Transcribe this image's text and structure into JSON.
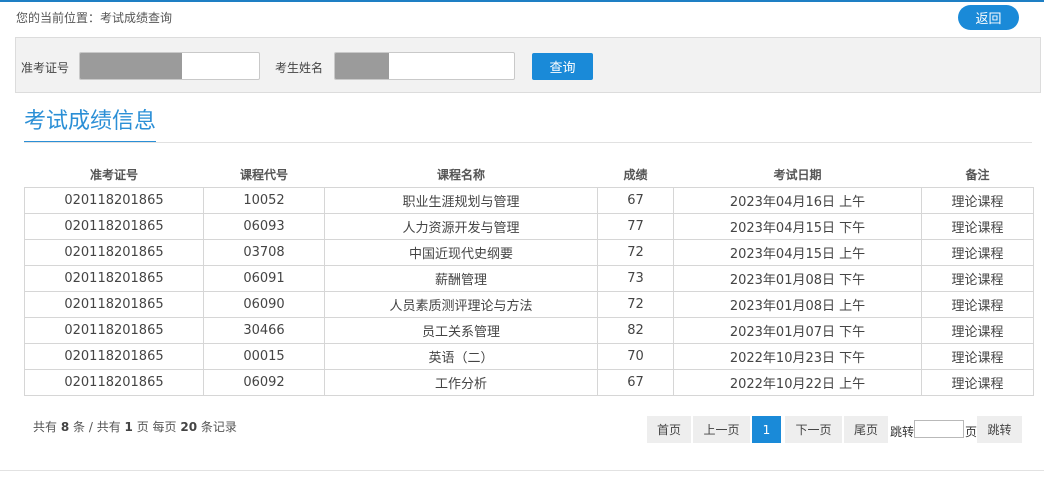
{
  "breadcrumb": {
    "text": "您的当前位置：考试成绩查询"
  },
  "header": {
    "back_label": "返回"
  },
  "search": {
    "exam_id_label": "准考证号",
    "exam_id_value": "",
    "name_label": "考生姓名",
    "name_value": "",
    "query_label": "查询"
  },
  "section": {
    "title": "考试成绩信息"
  },
  "table": {
    "headers": [
      "准考证号",
      "课程代号",
      "课程名称",
      "成绩",
      "考试日期",
      "备注"
    ],
    "rows": [
      [
        "020118201865",
        "10052",
        "职业生涯规划与管理",
        "67",
        "2023年04月16日 上午",
        "理论课程"
      ],
      [
        "020118201865",
        "06093",
        "人力资源开发与管理",
        "77",
        "2023年04月15日 下午",
        "理论课程"
      ],
      [
        "020118201865",
        "03708",
        "中国近现代史纲要",
        "72",
        "2023年04月15日 上午",
        "理论课程"
      ],
      [
        "020118201865",
        "06091",
        "薪酬管理",
        "73",
        "2023年01月08日 下午",
        "理论课程"
      ],
      [
        "020118201865",
        "06090",
        "人员素质测评理论与方法",
        "72",
        "2023年01月08日 上午",
        "理论课程"
      ],
      [
        "020118201865",
        "30466",
        "员工关系管理",
        "82",
        "2023年01月07日 下午",
        "理论课程"
      ],
      [
        "020118201865",
        "00015",
        "英语（二）",
        "70",
        "2022年10月23日 下午",
        "理论课程"
      ],
      [
        "020118201865",
        "06092",
        "工作分析",
        "67",
        "2022年10月22日 上午",
        "理论课程"
      ]
    ]
  },
  "summary": {
    "prefix": "共有",
    "total_count": "8",
    "count_unit": "条 / 共有",
    "page_count": "1",
    "page_unit": "页 每页",
    "per_page": "20",
    "per_page_unit": "条记录"
  },
  "pager": {
    "first": "首页",
    "prev": "上一页",
    "current": "1",
    "next": "下一页",
    "last": "尾页",
    "jump_prefix": "跳转",
    "jump_value": "",
    "jump_suffix": "页",
    "jump_button": "跳转"
  },
  "colors": {
    "accent": "#1a8ad8",
    "title": "#2b8fd6"
  }
}
